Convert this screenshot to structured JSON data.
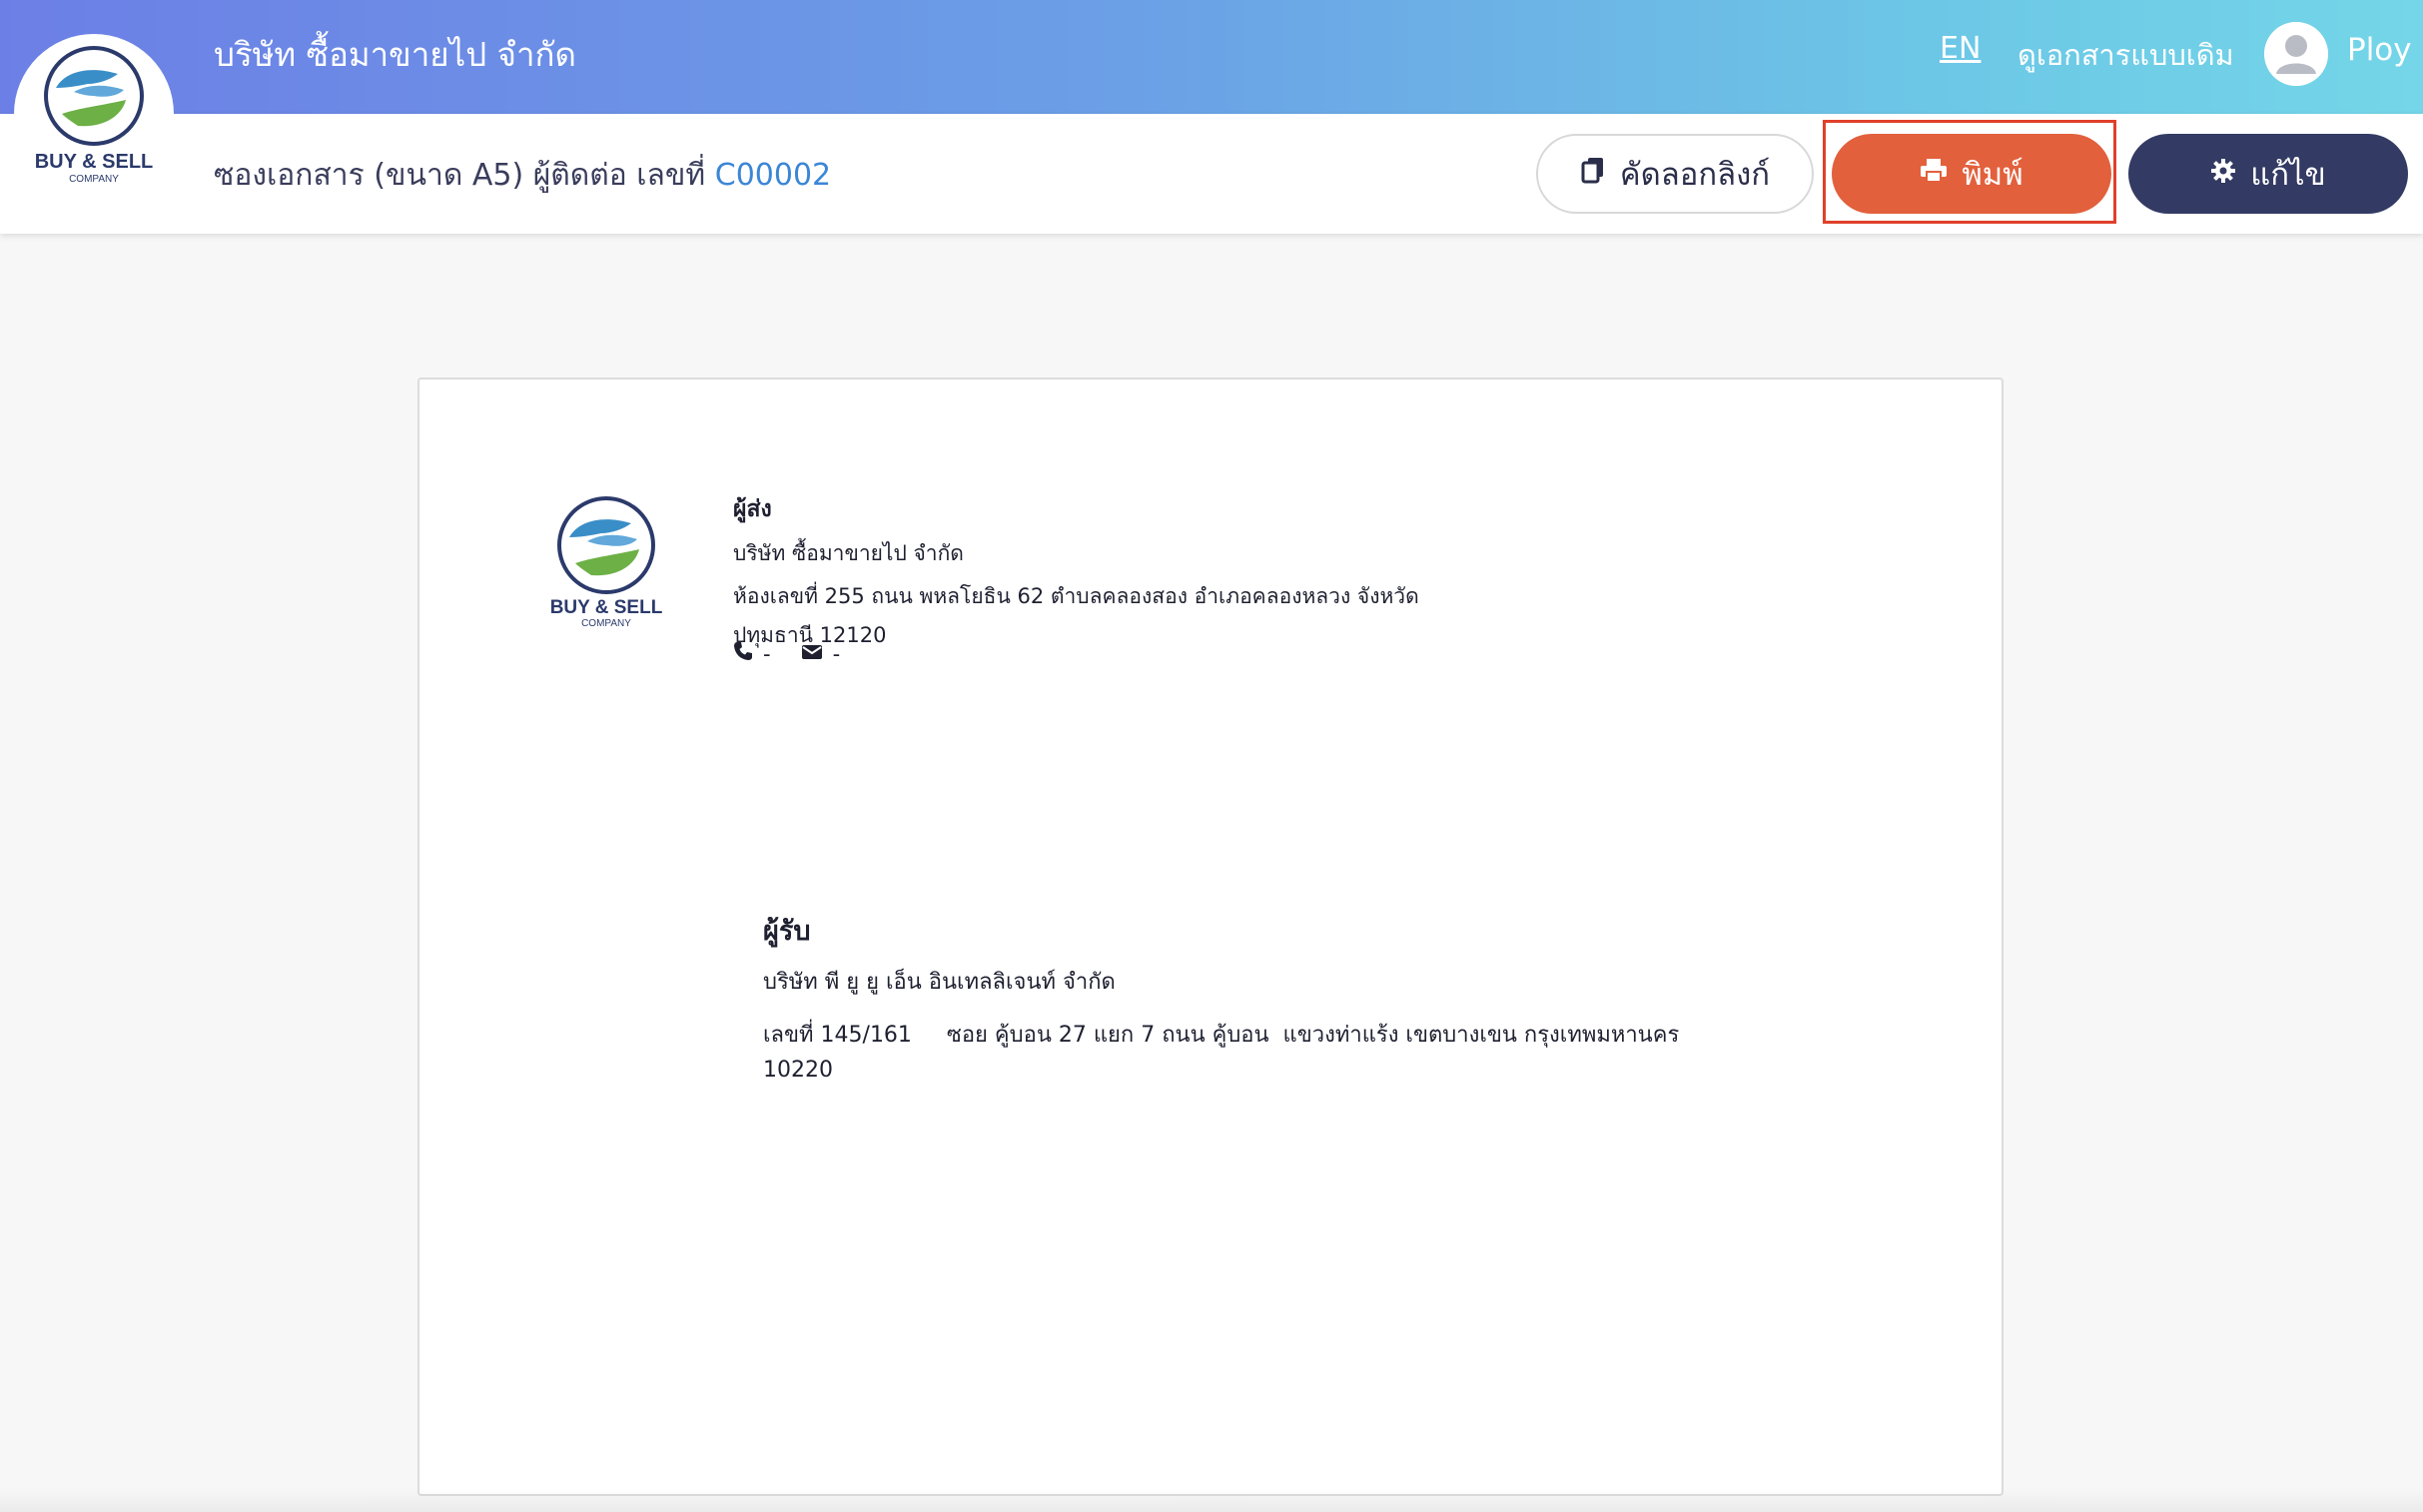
{
  "topbar": {
    "company_name": "บริษัท ซื้อมาขายไป จำกัด",
    "lang_link": "EN",
    "old_docs_link": "ดูเอกสารแบบเดิม",
    "user_name": "Ploy",
    "avatar_icon": "user-avatar-icon"
  },
  "logo": {
    "line1": "BUY & SELL",
    "line2": "COMPANY"
  },
  "subheader": {
    "title_prefix": "ซองเอกสาร (ขนาด A5) ผู้ติดต่อ เลขที่ ",
    "doc_number": "C00002",
    "copy_label": "คัดลอกลิงก์",
    "print_label": "พิมพ์",
    "edit_label": "แก้ไข"
  },
  "envelope": {
    "sender": {
      "label": "ผู้ส่ง",
      "name": "บริษัท ซื้อมาขายไป จำกัด",
      "address_line1": "ห้องเลขที่ 255 ถนน พหลโยธิน 62 ตำบลคลองสอง อำเภอคลองหลวง จังหวัด",
      "address_line2": "ปทุมธานี 12120",
      "phone": "-",
      "email": "-"
    },
    "recipient": {
      "label": "ผู้รับ",
      "name": "บริษัท พี ยู ยู เอ็น อินเทลลิเจนท์ จำกัด",
      "address_line1": "เลขที่ 145/161     ซอย คู้บอน 27 แยก 7 ถนน คู้บอน  แขวงท่าแร้ง เขตบางเขน กรุงเทพมหานคร",
      "address_line2": "10220"
    }
  },
  "colors": {
    "gradient_start": "#6c7fe6",
    "gradient_end": "#74d6e8",
    "print_button": "#e2603c",
    "edit_button": "#333a63",
    "doc_number": "#3b86d6",
    "highlight_box": "#e0402a"
  }
}
